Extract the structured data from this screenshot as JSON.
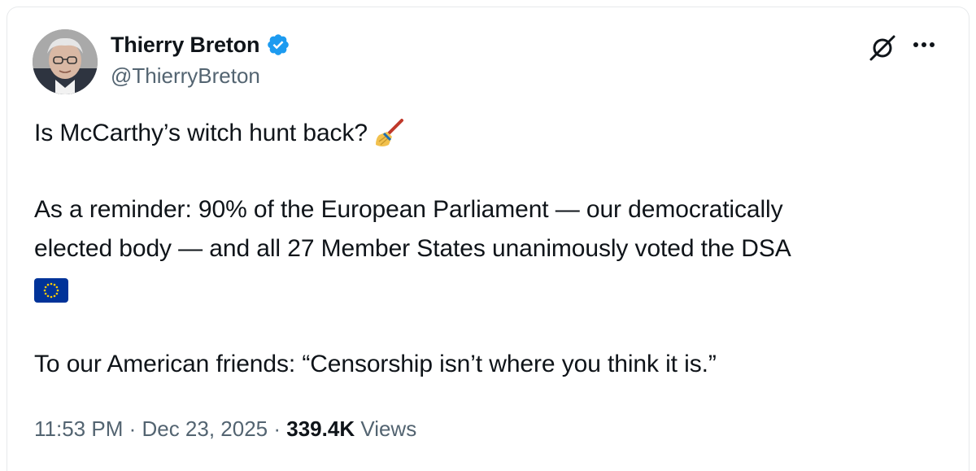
{
  "author": {
    "display_name": "Thierry Breton",
    "handle": "@ThierryBreton",
    "verified": true
  },
  "tweet": {
    "line1": "Is McCarthy’s witch hunt back?",
    "line1_emoji": "broom-emoji",
    "line2": "As a reminder: 90% of the European Parliament — our democratically",
    "line3": "elected body — and all 27 Member States unanimously voted the DSA",
    "line4_emoji": "eu-flag-emoji",
    "line5": "To our American friends: “Censorship isn’t where you think it is.”"
  },
  "meta": {
    "time": "11:53 PM",
    "separator": " · ",
    "date": "Dec 23, 2025",
    "views_count": "339.4K",
    "views_label": "Views"
  },
  "icons": {
    "grok": "grok-icon",
    "more": "more-options-icon"
  },
  "colors": {
    "text": "#0f1419",
    "secondary": "#536471",
    "verified_blue": "#1d9bf0",
    "eu_blue": "#003399",
    "eu_gold": "#ffcc00"
  }
}
